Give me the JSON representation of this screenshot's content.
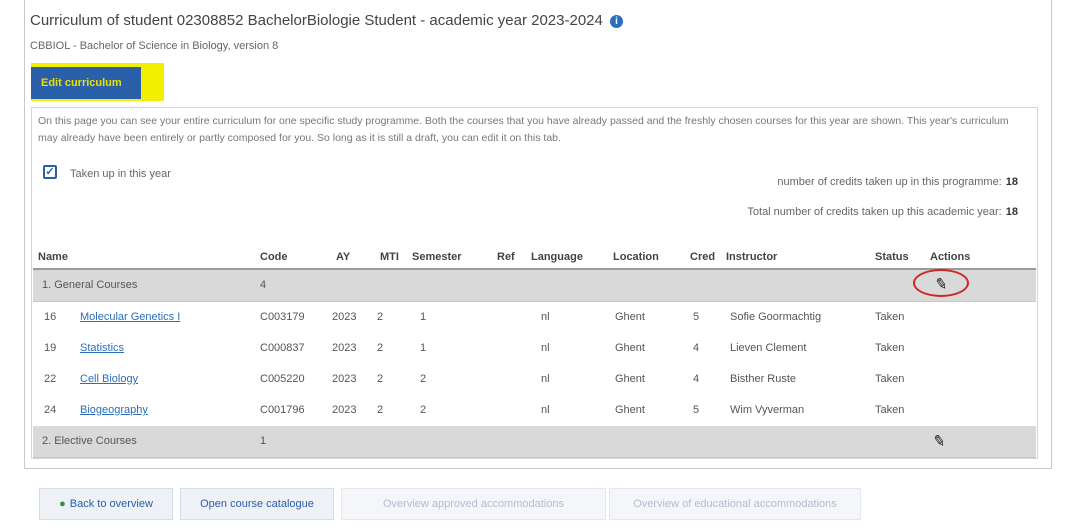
{
  "header": {
    "title": "Curriculum of student 02308852 Bachelor­Biologie Student - academic year 2023-2024",
    "subtitle": "CBBIOL - Bachelor of Science in Biology, version 8"
  },
  "edit_button": {
    "label": "Edit curriculum"
  },
  "intro_text": "On this page you can see your entire curriculum for one specific study programme. Both the courses that you have already passed and the freshly chosen courses for this year are shown. This year's curriculum may already have been entirely or partly composed for you. So long as it is still a draft, you can edit it on this tab.",
  "filter": {
    "label": "Taken up in this year",
    "checked": true
  },
  "credits": {
    "programme_label": "number of credits taken up in this programme:",
    "programme_value": "18",
    "year_label": "Total number of credits taken up this academic year:",
    "year_value": "18"
  },
  "table": {
    "headers": {
      "name": "Name",
      "code": "Code",
      "ay": "AY",
      "mti": "MTI",
      "semester": "Semester",
      "ref": "Ref",
      "language": "Language",
      "location": "Location",
      "credits": "Cred",
      "instructor": "Instructor",
      "status": "Status",
      "actions": "Actions"
    },
    "groups": [
      {
        "name": "1. General Courses",
        "count": "4"
      },
      {
        "name": "2. Elective Courses",
        "count": "1"
      }
    ],
    "rows": [
      {
        "num": "16",
        "name": "Molecular Genetics I",
        "code": "C003179",
        "ay": "2023",
        "mti": "2",
        "semester": "1",
        "language": "nl",
        "location": "Ghent",
        "credits": "5",
        "instructor": "Sofie Goormachtig",
        "status": "Taken"
      },
      {
        "num": "19",
        "name": "Statistics",
        "code": "C000837",
        "ay": "2023",
        "mti": "2",
        "semester": "1",
        "language": "nl",
        "location": "Ghent",
        "credits": "4",
        "instructor": "Lieven Clement",
        "status": "Taken"
      },
      {
        "num": "22",
        "name": "Cell Biology",
        "code": "C005220",
        "ay": "2023",
        "mti": "2",
        "semester": "2",
        "language": "nl",
        "location": "Ghent",
        "credits": "4",
        "instructor": "Bisther Ruste",
        "status": "Taken"
      },
      {
        "num": "24",
        "name": "Biogeography",
        "code": "C001796",
        "ay": "2023",
        "mti": "2",
        "semester": "2",
        "language": "nl",
        "location": "Ghent",
        "credits": "5",
        "instructor": "Wim Vyverman",
        "status": "Taken"
      }
    ]
  },
  "footer": {
    "back": "Back to overview",
    "catalogue": "Open course catalogue",
    "approved": "Overview approved accommodations",
    "educational": "Overview of educational accommodations"
  }
}
